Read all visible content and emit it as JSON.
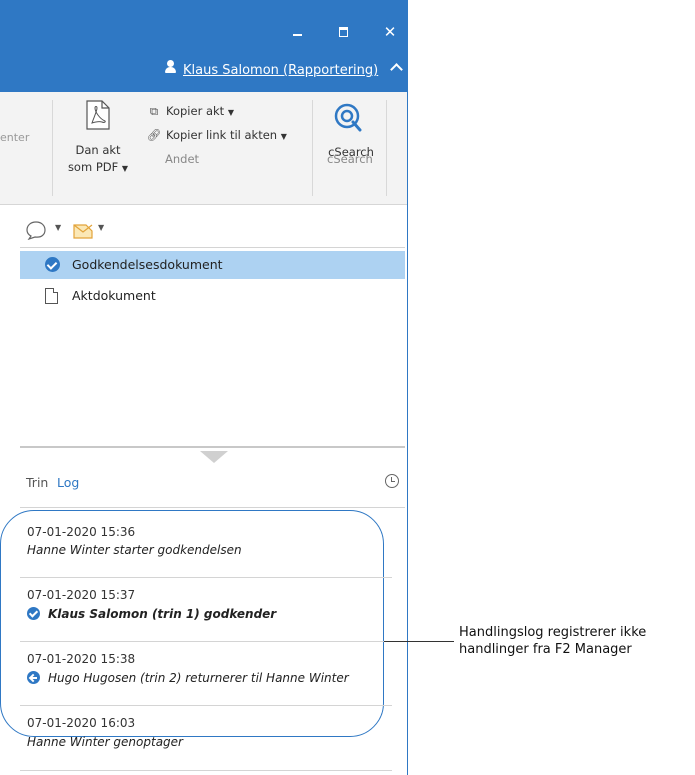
{
  "window": {
    "user_name": "Klaus Salomon (Rapportering)"
  },
  "ribbon": {
    "cut_label": "enter",
    "dan_akt_line1": "Dan akt",
    "dan_akt_line2": "som PDF",
    "kopier_akt": "Kopier akt",
    "kopier_link": "Kopier link til akten",
    "group_andet": "Andet",
    "csearch_button": "cSearch",
    "group_csearch": "cSearch"
  },
  "documents": [
    {
      "label": "Godkendelsesdokument",
      "selected": true,
      "icon": "check-icon"
    },
    {
      "label": "Aktdokument",
      "selected": false,
      "icon": "file-icon"
    }
  ],
  "tabs": {
    "trin": "Trin",
    "log": "Log"
  },
  "log_entries": [
    {
      "date": "07-01-2020 15:36",
      "text": "Hanne Winter starter godkendelsen"
    },
    {
      "date": "07-01-2020 15:37",
      "text": "Klaus Salomon (trin 1) godkender",
      "icon": "check-icon"
    },
    {
      "date": "07-01-2020 15:38",
      "text": "Hugo Hugosen (trin 2) returnerer til Hanne Winter",
      "icon": "back-arrow-icon"
    },
    {
      "date": "07-01-2020 16:03",
      "text": "Hanne Winter genoptager"
    }
  ],
  "callout": {
    "line1": "Handlingslog registrerer ikke",
    "line2": "handlinger fra F2 Manager"
  },
  "colors": {
    "accent": "#2f78c4",
    "selection": "#add2f2"
  }
}
